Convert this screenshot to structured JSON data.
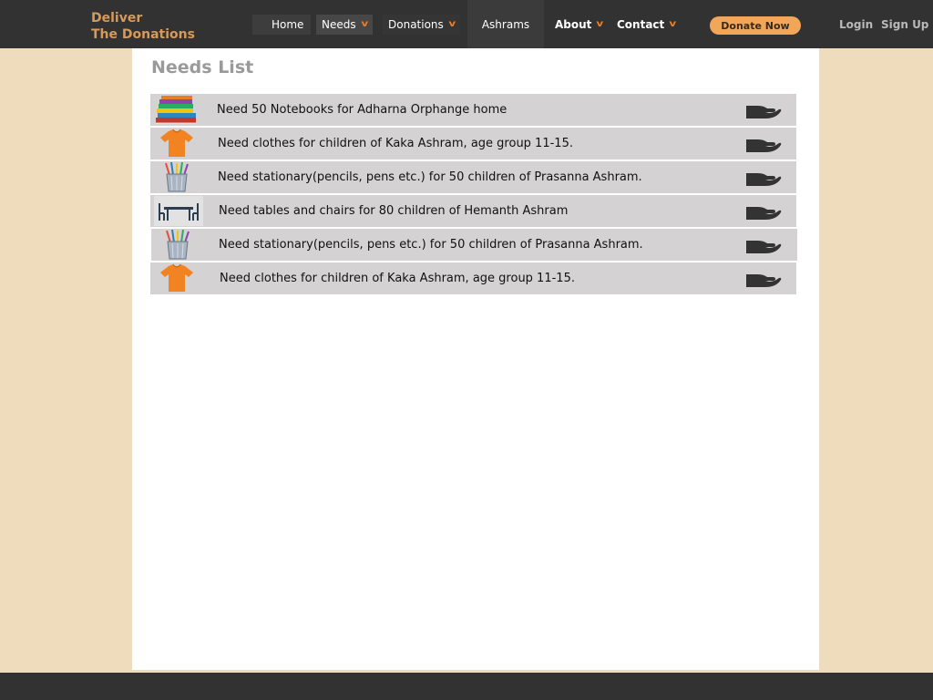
{
  "logo": {
    "line1": "Deliver",
    "line2": "The Donations"
  },
  "nav": {
    "home": "Home",
    "needs": "Needs",
    "donations": "Donations",
    "ashrams": "Ashrams",
    "about": "About",
    "contact": "Contact",
    "donate_now": "Donate Now",
    "login": "Login",
    "signup": "Sign Up"
  },
  "colors": {
    "nav_bg": "#323232",
    "accent_orange": "#f07c1e",
    "donate_button": "#f2a65a",
    "page_bg": "#efdcbc",
    "row_bg": "#d4d2d3"
  },
  "main": {
    "title": "Needs List",
    "needs": [
      {
        "icon": "books-icon",
        "text": "Need 50 Notebooks for Adharna Orphange home"
      },
      {
        "icon": "shirt-icon",
        "text": "Need clothes for children of Kaka Ashram, age group 11-15."
      },
      {
        "icon": "pencil-cup-icon",
        "text": "Need stationary(pencils, pens etc.) for 50 children of Prasanna Ashram."
      },
      {
        "icon": "table-chairs-icon",
        "text": "Need tables and chairs for 80 children of Hemanth Ashram"
      },
      {
        "icon": "pencil-cup-icon",
        "text": "Need stationary(pencils, pens etc.) for 50 children of Prasanna Ashram."
      },
      {
        "icon": "shirt-icon",
        "text": "Need clothes for children of Kaka Ashram, age group 11-15."
      }
    ],
    "donate_hand_icon": "giving-hand-icon"
  }
}
